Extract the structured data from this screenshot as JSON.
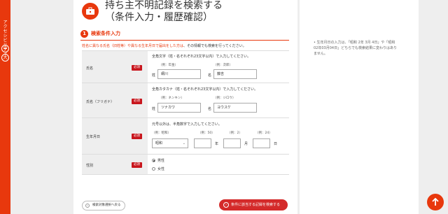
{
  "sidebar_left": {
    "vertical_text": "アクセシビリティ",
    "buttons": [
      {
        "label": "中"
      },
      {
        "label": "大"
      }
    ]
  },
  "title": {
    "line1": "持ち主不明記録を検索する",
    "line2": "（条件入力・履歴確認）"
  },
  "section": {
    "number": "1",
    "title": "検索条件入力"
  },
  "note": {
    "red": "姓名に異なる氏名（旧姓等）や異なる生年月日で届出をした方は",
    "black": "、その情報でも検索を行ってください。"
  },
  "form": {
    "required_label": "必須",
    "name": {
      "label": "氏名",
      "hint": "全角文字（姓・名それぞれ23文字以内）で入力してください。",
      "last_example": "（例：年金）",
      "first_example": "（例：次郎）",
      "last_prefix": "姓",
      "first_prefix": "名",
      "last_value": "綱川",
      "first_value": "藤吉"
    },
    "kana": {
      "label": "氏名（フリガナ）",
      "hint": "全角カタカナ（姓・名それぞれ23文字以内）で入力してください。",
      "last_example": "（例：ネンキン）",
      "first_example": "（例：ジロウ）",
      "last_prefix": "姓",
      "first_prefix": "名",
      "last_value": "ツナカワ",
      "first_value": "ヨウスケ"
    },
    "birth": {
      "label": "生年月日",
      "hint": "元号以外は、半角数字で入力してください。",
      "era_example": "（例：昭和）",
      "year_example": "（例：50）",
      "month_example": "（例：2）",
      "day_example": "（例：24）",
      "era_value": "昭和",
      "year_unit": "年",
      "month_unit": "月",
      "day_unit": "日",
      "year_value": "",
      "month_value": "",
      "day_value": ""
    },
    "gender": {
      "label": "性別",
      "options": [
        {
          "label": "男性",
          "selected": true
        },
        {
          "label": "女性",
          "selected": false
        }
      ]
    }
  },
  "buttons": {
    "back": "検索対象選択へ戻る",
    "search": "条件に該当する記録を検索する"
  },
  "side_note": "生年月日の入力は、「昭和 2年 3月 4日」や「昭和02年03月04日」どちらでも検索結果に変わりはありません。",
  "colors": {
    "accent": "#e8380d",
    "required": "#c8161d",
    "label_bg": "#eeeeee"
  }
}
